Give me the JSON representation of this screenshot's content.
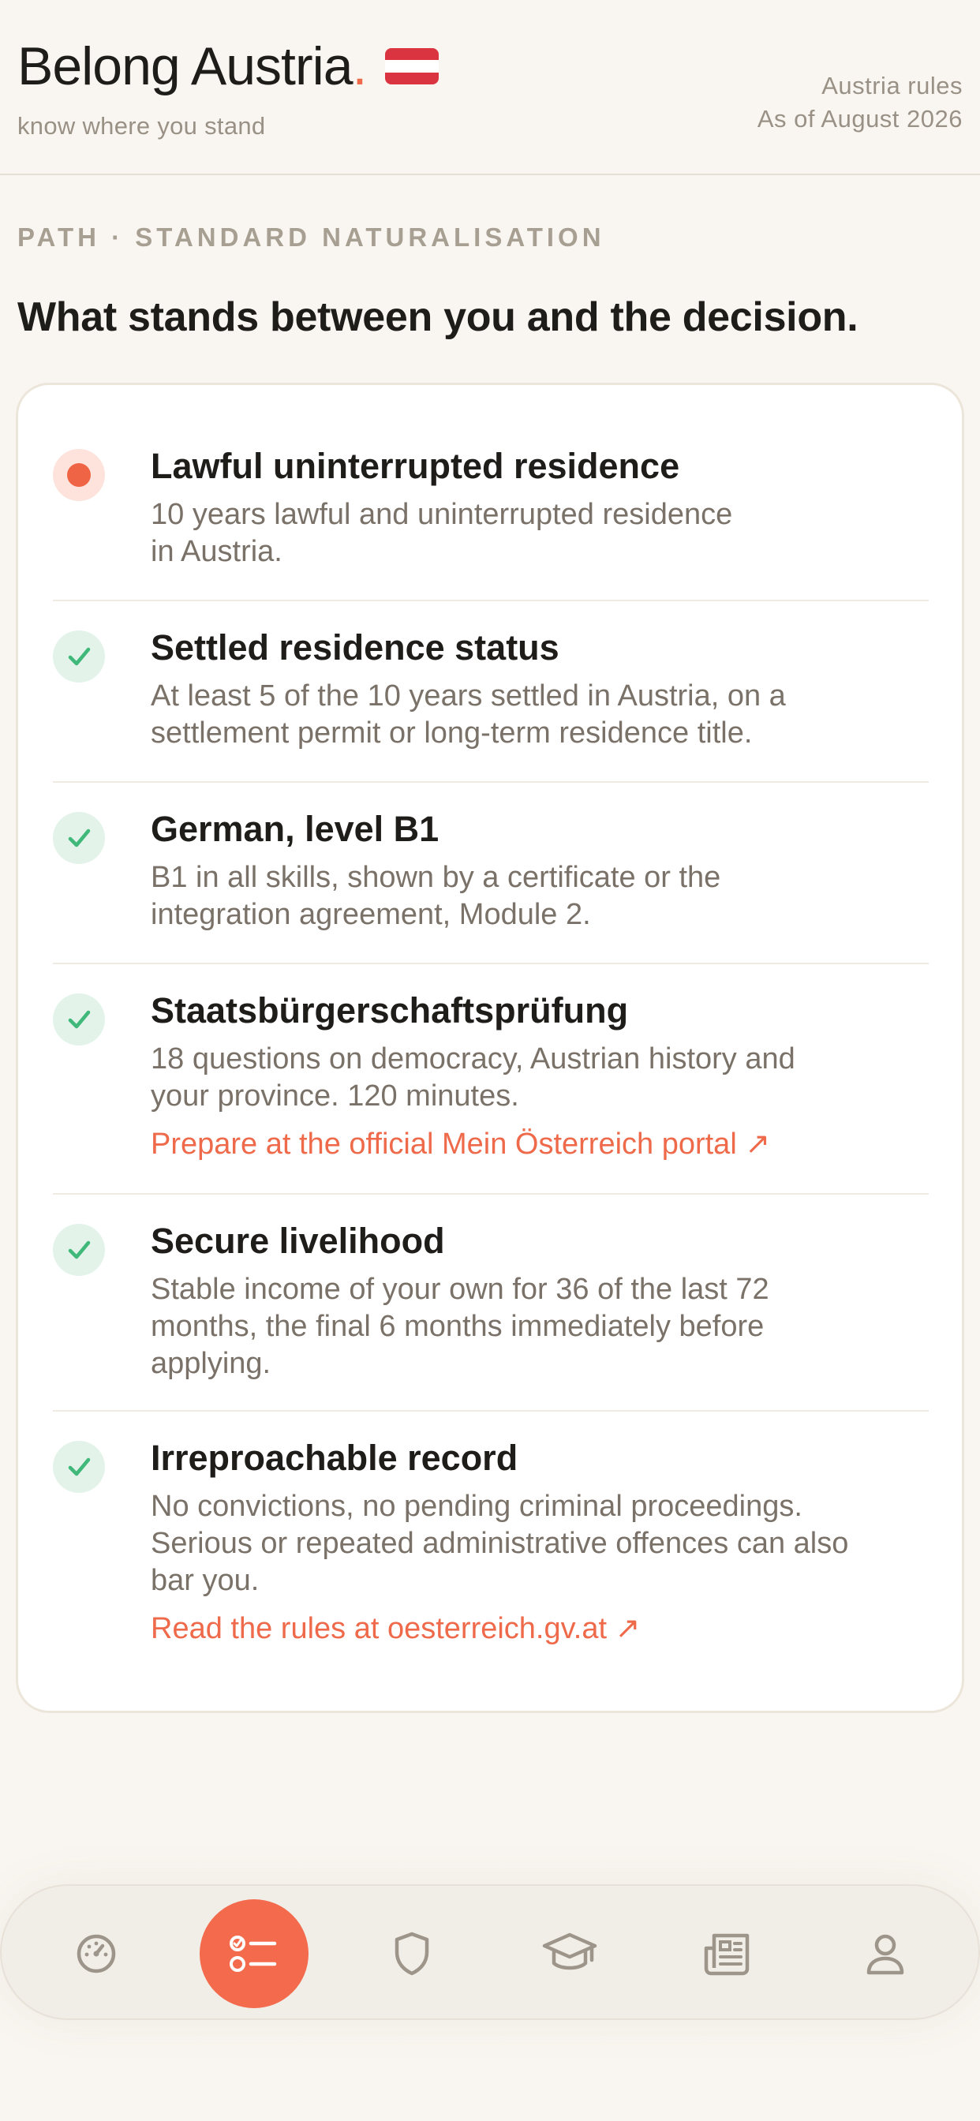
{
  "header": {
    "title": "Belong Austria",
    "title_dot": ".",
    "tagline": "know where you stand",
    "rules_label": "Austria rules",
    "as_of": "As of August 2026"
  },
  "section": {
    "eyebrow": "PATH · STANDARD NATURALISATION",
    "headline": "What stands between you and the decision."
  },
  "requirements": [
    {
      "status": "current",
      "title": "Lawful uninterrupted residence",
      "desc_lines": [
        "10 years lawful and uninterrupted residence",
        "in Austria."
      ]
    },
    {
      "status": "done",
      "title": "Settled residence status",
      "desc_lines": [
        "At least 5 of the 10 years settled in Austria, on a",
        "settlement permit or long-term residence title."
      ]
    },
    {
      "status": "done",
      "title": "German, level B1",
      "desc_lines": [
        "B1 in all skills, shown by a certificate or the",
        "integration agreement, Module 2."
      ]
    },
    {
      "status": "done",
      "title": "Staatsbürgerschaftsprüfung",
      "desc_lines": [
        "18 questions on democracy, Austrian history and",
        "your province. 120 minutes."
      ],
      "link": "Prepare at the official Mein Österreich portal ↗"
    },
    {
      "status": "done",
      "title": "Secure livelihood",
      "desc_lines": [
        "Stable income of your own for 36 of the last 72",
        "months, the final 6 months immediately before",
        "applying."
      ]
    },
    {
      "status": "done",
      "title": "Irreproachable record",
      "desc_lines": [
        "No convictions, no pending criminal proceedings.",
        "Serious or repeated administrative offences can also",
        "bar you."
      ],
      "link": "Read the rules at oesterreich.gv.at ↗"
    }
  ],
  "nav": {
    "items": [
      {
        "icon": "dashboard-gauge-icon"
      },
      {
        "icon": "checklist-icon",
        "active": true
      },
      {
        "icon": "shield-icon"
      },
      {
        "icon": "graduation-cap-icon"
      },
      {
        "icon": "newspaper-icon"
      },
      {
        "icon": "profile-icon"
      }
    ]
  },
  "colors": {
    "accent": "#ee6a4a",
    "done": "#3fb87a",
    "background": "#f9f6f1"
  }
}
